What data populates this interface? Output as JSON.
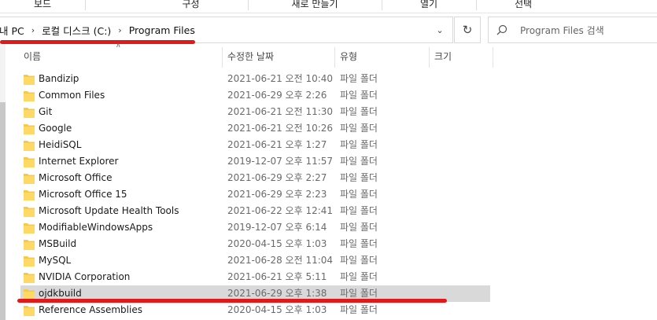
{
  "ribbon": {
    "groups": [
      "보드",
      "구성",
      "새로 만들기",
      "열기",
      "선택"
    ]
  },
  "address": {
    "crumbs": [
      "내 PC",
      "로컬 디스크 (C:)",
      "Program Files"
    ]
  },
  "search": {
    "placeholder": "Program Files 검색"
  },
  "columns": {
    "name": "이름",
    "date": "수정한 날짜",
    "type": "유형",
    "size": "크기"
  },
  "files": [
    {
      "name": "Bandizip",
      "date": "2021-06-21 오전 10:40",
      "type": "파일 폴더"
    },
    {
      "name": "Common Files",
      "date": "2021-06-29 오후 2:26",
      "type": "파일 폴더"
    },
    {
      "name": "Git",
      "date": "2021-06-21 오전 11:30",
      "type": "파일 폴더"
    },
    {
      "name": "Google",
      "date": "2021-06-21 오전 10:26",
      "type": "파일 폴더"
    },
    {
      "name": "HeidiSQL",
      "date": "2021-06-21 오후 1:27",
      "type": "파일 폴더"
    },
    {
      "name": "Internet Explorer",
      "date": "2019-12-07 오후 11:57",
      "type": "파일 폴더"
    },
    {
      "name": "Microsoft Office",
      "date": "2021-06-29 오후 2:27",
      "type": "파일 폴더"
    },
    {
      "name": "Microsoft Office 15",
      "date": "2021-06-29 오후 2:23",
      "type": "파일 폴더"
    },
    {
      "name": "Microsoft Update Health Tools",
      "date": "2021-06-22 오후 12:41",
      "type": "파일 폴더"
    },
    {
      "name": "ModifiableWindowsApps",
      "date": "2019-12-07 오후 6:14",
      "type": "파일 폴더"
    },
    {
      "name": "MSBuild",
      "date": "2020-04-15 오후 1:03",
      "type": "파일 폴더"
    },
    {
      "name": "MySQL",
      "date": "2021-06-28 오전 11:04",
      "type": "파일 폴더"
    },
    {
      "name": "NVIDIA Corporation",
      "date": "2021-06-21 오후 5:11",
      "type": "파일 폴더"
    },
    {
      "name": "ojdkbuild",
      "date": "2021-06-29 오후 1:38",
      "type": "파일 폴더",
      "selected": true
    },
    {
      "name": "Reference Assemblies",
      "date": "2020-04-15 오후 1:03",
      "type": "파일 폴더"
    }
  ],
  "colors": {
    "annotation": "#e0191b",
    "selection": "#d9d9d9",
    "folder": "#f7c948"
  }
}
